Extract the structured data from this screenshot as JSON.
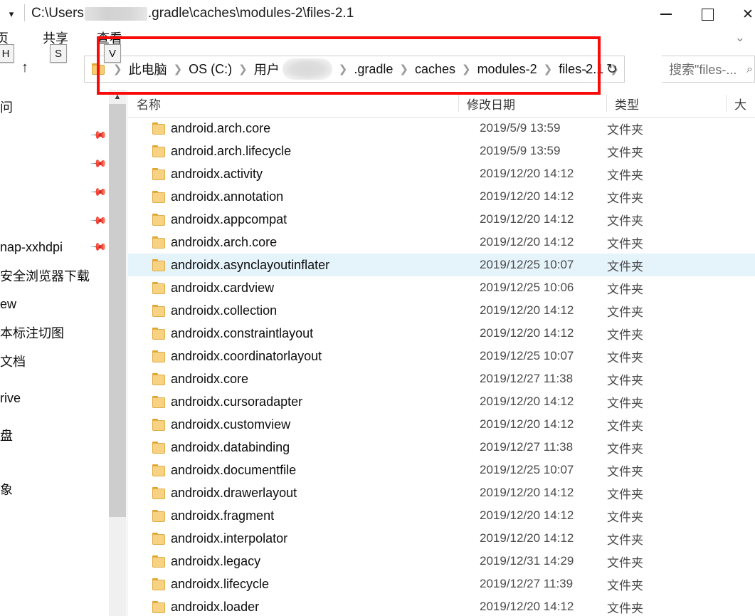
{
  "window": {
    "title_prefix": "C:\\Users",
    "title_suffix": ".gradle\\caches\\modules-2\\files-2.1",
    "quick_access_caret": "▾",
    "minimize_label": "最小化",
    "maximize_label": "最大化",
    "close_label": "关闭",
    "ribbon_expand_icon": "chevron-down-icon"
  },
  "ribbon": {
    "tabs": [
      {
        "label": "页",
        "keytip": "H"
      },
      {
        "label": "共享",
        "keytip": "S"
      },
      {
        "label": "查看",
        "keytip": "V"
      }
    ]
  },
  "address": {
    "up_arrow": "↑",
    "crumbs": [
      {
        "label": "此电脑",
        "redacted": false
      },
      {
        "label": "OS (C:)",
        "redacted": false
      },
      {
        "label": "用户",
        "redacted": false
      },
      {
        "label": "",
        "redacted": true
      },
      {
        "label": ".gradle",
        "redacted": false
      },
      {
        "label": "caches",
        "redacted": false
      },
      {
        "label": "modules-2",
        "redacted": false
      },
      {
        "label": "files-2.1",
        "redacted": false
      }
    ],
    "separator": "❯",
    "dropdown_caret": "⌄",
    "refresh_icon": "↻"
  },
  "search": {
    "placeholder": "搜索\"files-...",
    "icon": "search-icon"
  },
  "annotation": {
    "color": "#fa0a09",
    "shape": "rectangle"
  },
  "sidebar": {
    "items": [
      {
        "label": "问",
        "pinned": false
      },
      {
        "label": "",
        "pinned": true
      },
      {
        "label": "",
        "pinned": true
      },
      {
        "label": "",
        "pinned": true
      },
      {
        "label": "",
        "pinned": true
      },
      {
        "label": "nap-xxhdpi",
        "pinned": true
      },
      {
        "label": "安全浏览器下载",
        "pinned": false
      },
      {
        "label": "ew",
        "pinned": false
      },
      {
        "label": "本标注切图",
        "pinned": false
      },
      {
        "label": "文档",
        "pinned": false
      },
      {
        "label": "rive",
        "pinned": false
      },
      {
        "label": "盘",
        "pinned": false
      },
      {
        "label": "",
        "pinned": false
      },
      {
        "label": "象",
        "pinned": false
      }
    ],
    "scroll_up_icon": "chevron-up-icon"
  },
  "filelist": {
    "columns": [
      "名称",
      "修改日期",
      "类型",
      "大"
    ],
    "selected_index": 6,
    "rows": [
      {
        "name": "android.arch.core",
        "date": "2019/5/9 13:59",
        "type": "文件夹"
      },
      {
        "name": "android.arch.lifecycle",
        "date": "2019/5/9 13:59",
        "type": "文件夹"
      },
      {
        "name": "androidx.activity",
        "date": "2019/12/20 14:12",
        "type": "文件夹"
      },
      {
        "name": "androidx.annotation",
        "date": "2019/12/20 14:12",
        "type": "文件夹"
      },
      {
        "name": "androidx.appcompat",
        "date": "2019/12/20 14:12",
        "type": "文件夹"
      },
      {
        "name": "androidx.arch.core",
        "date": "2019/12/20 14:12",
        "type": "文件夹"
      },
      {
        "name": "androidx.asynclayoutinflater",
        "date": "2019/12/25 10:07",
        "type": "文件夹"
      },
      {
        "name": "androidx.cardview",
        "date": "2019/12/25 10:06",
        "type": "文件夹"
      },
      {
        "name": "androidx.collection",
        "date": "2019/12/20 14:12",
        "type": "文件夹"
      },
      {
        "name": "androidx.constraintlayout",
        "date": "2019/12/20 14:12",
        "type": "文件夹"
      },
      {
        "name": "androidx.coordinatorlayout",
        "date": "2019/12/25 10:07",
        "type": "文件夹"
      },
      {
        "name": "androidx.core",
        "date": "2019/12/27 11:38",
        "type": "文件夹"
      },
      {
        "name": "androidx.cursoradapter",
        "date": "2019/12/20 14:12",
        "type": "文件夹"
      },
      {
        "name": "androidx.customview",
        "date": "2019/12/20 14:12",
        "type": "文件夹"
      },
      {
        "name": "androidx.databinding",
        "date": "2019/12/27 11:38",
        "type": "文件夹"
      },
      {
        "name": "androidx.documentfile",
        "date": "2019/12/25 10:07",
        "type": "文件夹"
      },
      {
        "name": "androidx.drawerlayout",
        "date": "2019/12/20 14:12",
        "type": "文件夹"
      },
      {
        "name": "androidx.fragment",
        "date": "2019/12/20 14:12",
        "type": "文件夹"
      },
      {
        "name": "androidx.interpolator",
        "date": "2019/12/20 14:12",
        "type": "文件夹"
      },
      {
        "name": "androidx.legacy",
        "date": "2019/12/31 14:29",
        "type": "文件夹"
      },
      {
        "name": "androidx.lifecycle",
        "date": "2019/12/27 11:39",
        "type": "文件夹"
      },
      {
        "name": "androidx.loader",
        "date": "2019/12/20 14:12",
        "type": "文件夹"
      }
    ]
  }
}
